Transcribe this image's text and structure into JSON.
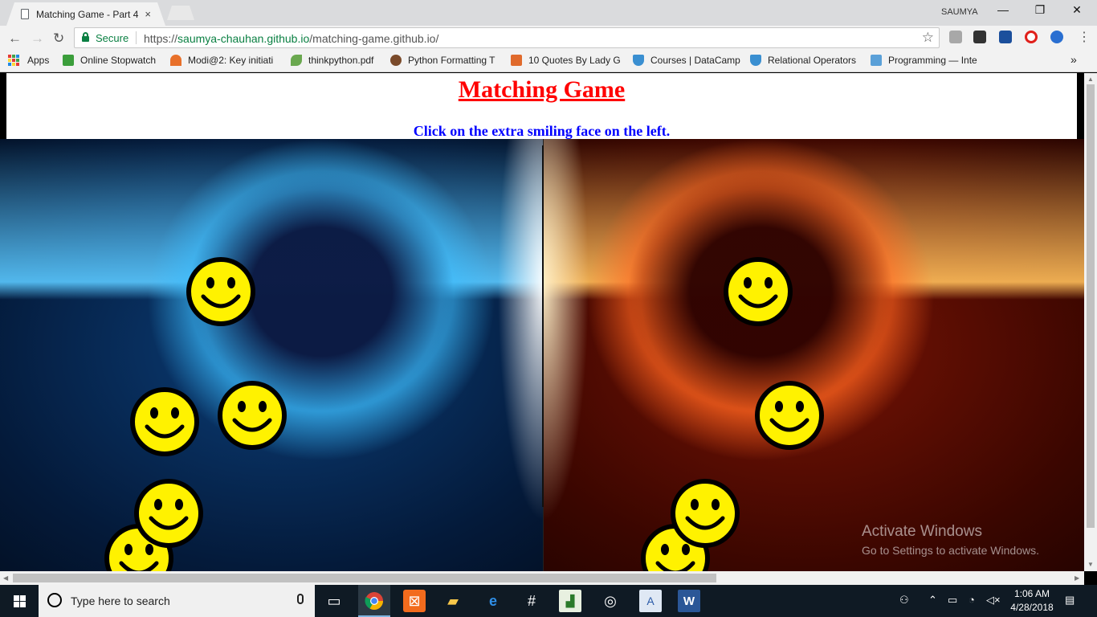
{
  "browser": {
    "tab_title": "Matching Game - Part 4",
    "tab_close": "×",
    "profile": "SAUMYA",
    "window_controls": [
      "—",
      "❐",
      "✕"
    ],
    "security_label": "Secure",
    "url_scheme": "https://",
    "url_host": "saumya-chauhan.github.io",
    "url_path": "/matching-game.github.io/",
    "bookmark_star": "☆",
    "nav": {
      "back": "←",
      "forward": "→",
      "reload": "↻"
    },
    "overflow": "»"
  },
  "bookmarks": [
    {
      "label": "Apps",
      "icon": "apps-grid-icon"
    },
    {
      "label": "Online Stopwatch",
      "icon": "stopwatch-icon",
      "color": "#3b9e3b"
    },
    {
      "label": "Modi@2: Key initiati",
      "icon": "rainbow-icon",
      "color": "#e8702a"
    },
    {
      "label": "thinkpython.pdf",
      "icon": "leaf-icon",
      "color": "#6aa84f"
    },
    {
      "label": "Python Formatting T",
      "icon": "cookie-icon",
      "color": "#7a4a2a"
    },
    {
      "label": "10 Quotes By Lady G",
      "icon": "s-icon",
      "color": "#e06a2c"
    },
    {
      "label": "Courses | DataCamp",
      "icon": "shield-icon",
      "color": "#3a8fd1"
    },
    {
      "label": "Relational Operators",
      "icon": "shield-icon",
      "color": "#3a8fd1"
    },
    {
      "label": "Programming — Inte",
      "icon": "beta-icon",
      "color": "#5aa0d8"
    }
  ],
  "page": {
    "title": "Matching Game",
    "instruction": "Click on the extra smiling face on the left."
  },
  "game": {
    "left_faces": 5,
    "right_faces": 4,
    "face_color": "#fff200"
  },
  "watermark": {
    "line1": "Activate Windows",
    "line2": "Go to Settings to activate Windows."
  },
  "taskbar": {
    "search_placeholder": "Type here to search",
    "time": "1:06 AM",
    "date": "4/28/2018"
  }
}
